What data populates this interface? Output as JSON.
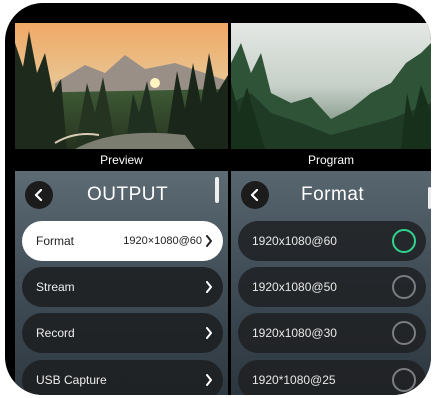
{
  "preview": {
    "caption": "Preview"
  },
  "program": {
    "caption": "Program"
  },
  "output_panel": {
    "title": "OUTPUT",
    "items": [
      {
        "label": "Format",
        "value": "1920×1080@60",
        "selected": true
      },
      {
        "label": "Stream",
        "value": "",
        "selected": false
      },
      {
        "label": "Record",
        "value": "",
        "selected": false
      },
      {
        "label": "USB Capture",
        "value": "",
        "selected": false
      }
    ]
  },
  "format_panel": {
    "title": "Format",
    "options": [
      {
        "label": "1920x1080@60",
        "selected": true
      },
      {
        "label": "1920x1080@50",
        "selected": false
      },
      {
        "label": "1920x1080@30",
        "selected": false
      },
      {
        "label": "1920*1080@25",
        "selected": false
      }
    ]
  },
  "colors": {
    "selected_radio": "#2ed58e",
    "unselected_radio": "#7a7e82"
  }
}
